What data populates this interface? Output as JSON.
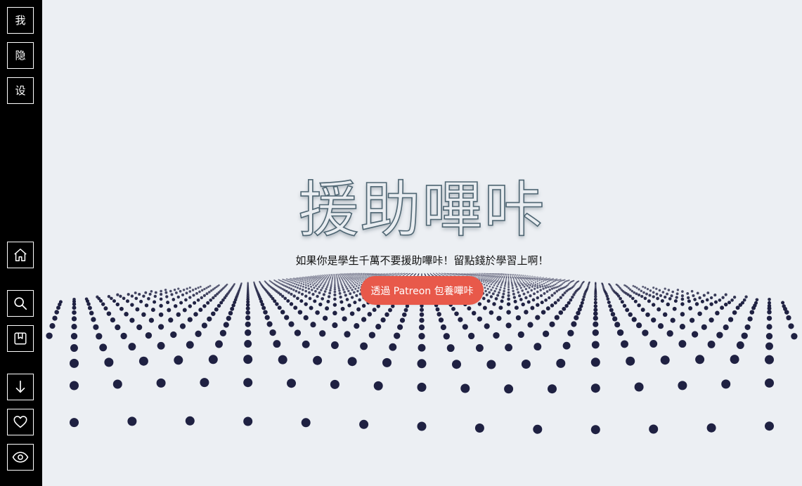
{
  "sidebar": {
    "top_buttons": [
      {
        "label": "我",
        "name": "me-button"
      },
      {
        "label": "隐",
        "name": "hide-button"
      },
      {
        "label": "设",
        "name": "settings-button"
      }
    ],
    "icon_buttons": [
      {
        "icon": "home-icon",
        "name": "home-button"
      },
      {
        "icon": "search-icon",
        "name": "search-button"
      },
      {
        "icon": "bookmark-icon",
        "name": "bookmark-button"
      },
      {
        "icon": "arrow-down-icon",
        "name": "scroll-down-button"
      },
      {
        "icon": "heart-icon",
        "name": "favorite-button"
      },
      {
        "icon": "eye-icon",
        "name": "view-button"
      }
    ]
  },
  "hero": {
    "title": "援助嗶咔",
    "subtitle": "如果你是學生千萬不要援助嗶咔！留點錢於學習上啊！",
    "button_label": "透過 Patreon 包養嗶咔"
  },
  "colors": {
    "sidebar_bg": "#000000",
    "page_bg": "#eceff3",
    "title_stroke": "#4f6673",
    "button_bg": "#e8594a",
    "dot_color": "#1f2142"
  }
}
